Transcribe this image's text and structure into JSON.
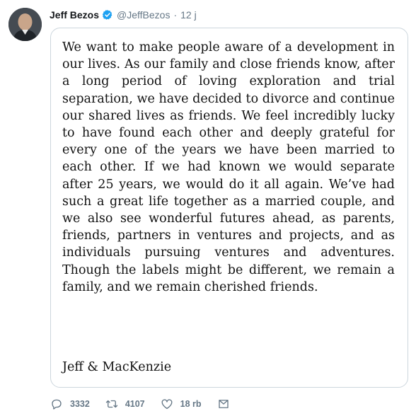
{
  "tweet": {
    "author_name": "Jeff Bezos",
    "handle": "@JeffBezos",
    "separator": "·",
    "time": "12 j",
    "statement": "We want to make people aware of a development in our lives. As our family and close friends know, after a long period of loving exploration and trial separation, we have decided to divorce and continue our shared lives as friends.  We feel incredibly lucky to have found each other and deeply grateful for every one of the years we have been married to each other.  If we had known we would separate after 25 years, we would do it all again.  We’ve had such a great life together as a married couple, and we also see wonderful futures ahead, as parents, friends, partners in ventures and projects, and as individuals pursuing ventures and adventures.  Though the labels might be different, we remain a family, and we remain cherished friends.",
    "signature": "Jeff & MacKenzie"
  },
  "actions": {
    "replies": "3332",
    "retweets": "4107",
    "likes": "18 rb"
  },
  "icons": {
    "verified": "verified-badge-icon",
    "reply": "reply-icon",
    "retweet": "retweet-icon",
    "like": "heart-icon",
    "share": "share-icon"
  },
  "colors": {
    "verified": "#1da1f2",
    "secondary_text": "#657786",
    "card_border": "#ccd6dd"
  }
}
